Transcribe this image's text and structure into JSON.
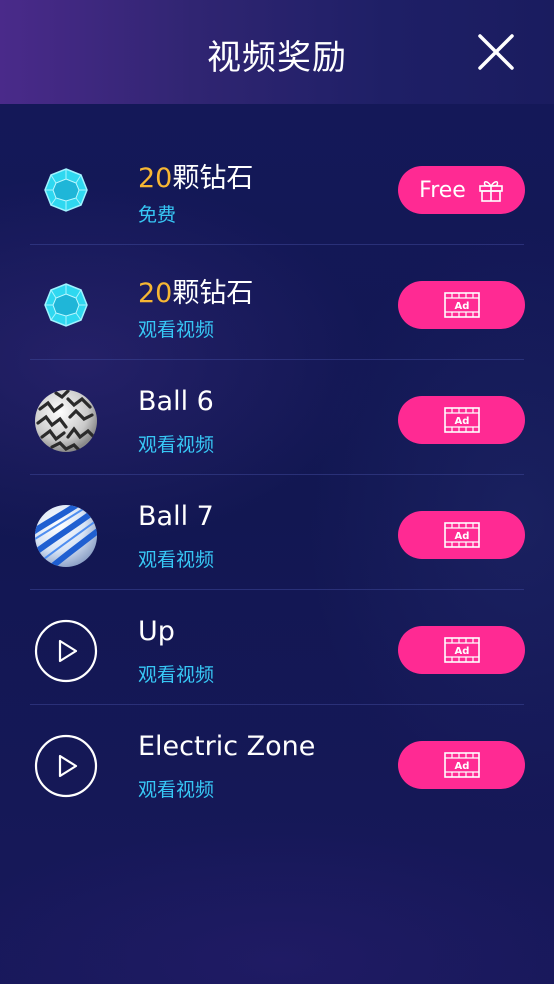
{
  "header": {
    "title": "视频奖励"
  },
  "rewards": [
    {
      "amount": "20",
      "name": "颗钻石",
      "subtitle": "免费",
      "icon": "diamond-icon",
      "button": "free",
      "button_label": "Free"
    },
    {
      "amount": "20",
      "name": "颗钻石",
      "subtitle": "观看视频",
      "icon": "diamond-icon",
      "button": "ad",
      "button_label": "Ad"
    },
    {
      "name": "Ball 6",
      "subtitle": "观看视频",
      "icon": "ball-6-icon",
      "button": "ad",
      "button_label": "Ad"
    },
    {
      "name": "Ball 7",
      "subtitle": "观看视频",
      "icon": "ball-7-icon",
      "button": "ad",
      "button_label": "Ad"
    },
    {
      "name": "Up",
      "subtitle": "观看视频",
      "icon": "play-icon",
      "button": "ad",
      "button_label": "Ad"
    },
    {
      "name": "Electric Zone",
      "subtitle": "观看视频",
      "icon": "play-icon",
      "button": "ad",
      "button_label": "Ad"
    }
  ],
  "colors": {
    "accent_button": "#ff2a93",
    "subtitle": "#37c7f5",
    "amount": "#f7b733",
    "diamond": "#2fd8f0"
  }
}
